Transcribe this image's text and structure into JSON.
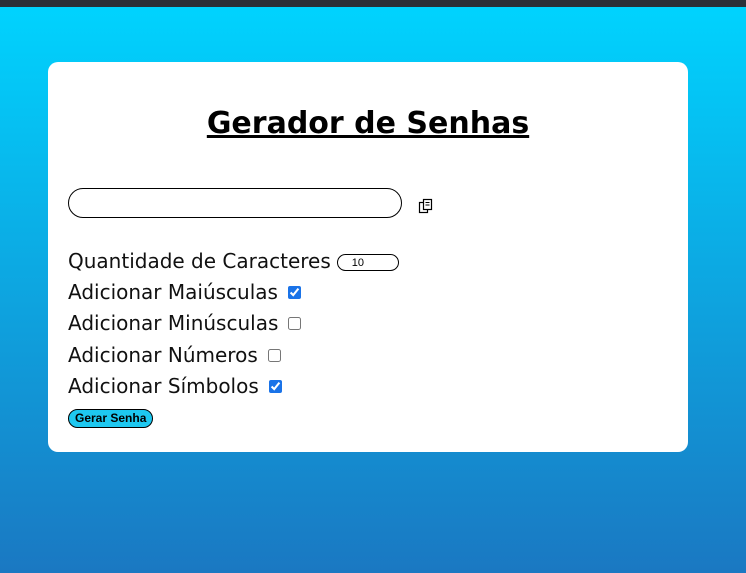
{
  "app": {
    "title": "Gerador de Senhas"
  },
  "password": {
    "value": "",
    "placeholder": ""
  },
  "options": {
    "length_label": "Quantidade de Caracteres",
    "length_value": "10",
    "uppercase_label": "Adicionar Maiúsculas",
    "uppercase_checked": true,
    "lowercase_label": "Adicionar Minúsculas",
    "lowercase_checked": false,
    "numbers_label": "Adicionar Números",
    "numbers_checked": false,
    "symbols_label": "Adicionar Símbolos",
    "symbols_checked": true
  },
  "actions": {
    "generate_label": "Gerar Senha",
    "copy_icon": "copy-icon"
  },
  "colors": {
    "background_top": "#00d4ff",
    "background_bottom": "#1a78c2",
    "button": "#1ec8f0",
    "checkbox_accent": "#1a73e8"
  }
}
